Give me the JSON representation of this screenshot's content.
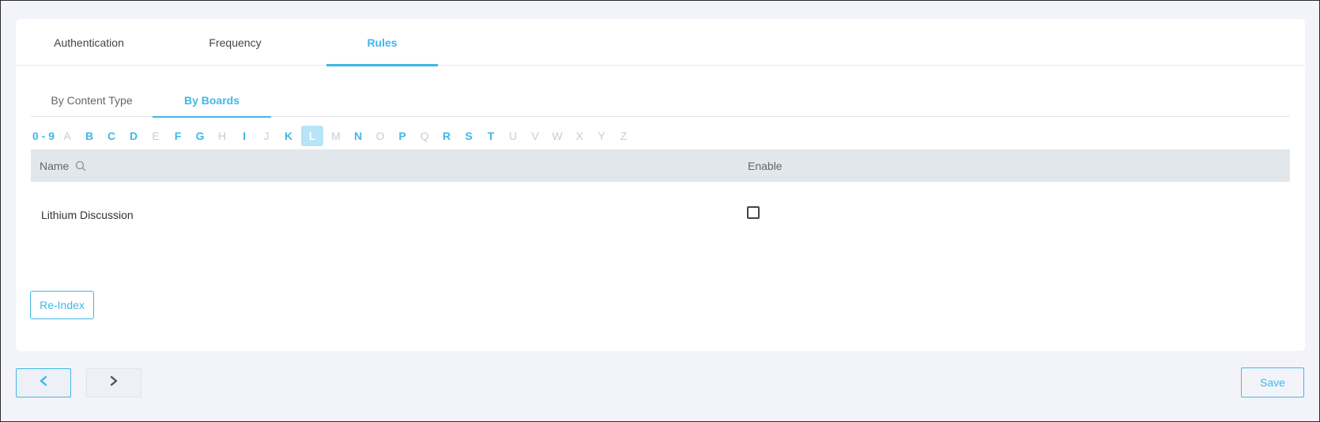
{
  "top_tabs": [
    {
      "label": "Authentication",
      "active": false
    },
    {
      "label": "Frequency",
      "active": false
    },
    {
      "label": "Rules",
      "active": true
    }
  ],
  "sub_tabs": [
    {
      "label": "By Content Type",
      "active": false
    },
    {
      "label": "By Boards",
      "active": true
    }
  ],
  "alphabet": [
    {
      "label": "0 - 9",
      "state": "on"
    },
    {
      "label": "A",
      "state": "off"
    },
    {
      "label": "B",
      "state": "on"
    },
    {
      "label": "C",
      "state": "on"
    },
    {
      "label": "D",
      "state": "on"
    },
    {
      "label": "E",
      "state": "off"
    },
    {
      "label": "F",
      "state": "on"
    },
    {
      "label": "G",
      "state": "on"
    },
    {
      "label": "H",
      "state": "off"
    },
    {
      "label": "I",
      "state": "on"
    },
    {
      "label": "J",
      "state": "off"
    },
    {
      "label": "K",
      "state": "on"
    },
    {
      "label": "L",
      "state": "selected"
    },
    {
      "label": "M",
      "state": "off"
    },
    {
      "label": "N",
      "state": "on"
    },
    {
      "label": "O",
      "state": "off"
    },
    {
      "label": "P",
      "state": "on"
    },
    {
      "label": "Q",
      "state": "off"
    },
    {
      "label": "R",
      "state": "on"
    },
    {
      "label": "S",
      "state": "on"
    },
    {
      "label": "T",
      "state": "on"
    },
    {
      "label": "U",
      "state": "off"
    },
    {
      "label": "V",
      "state": "off"
    },
    {
      "label": "W",
      "state": "off"
    },
    {
      "label": "X",
      "state": "off"
    },
    {
      "label": "Y",
      "state": "off"
    },
    {
      "label": "Z",
      "state": "off"
    }
  ],
  "table": {
    "columns": {
      "name": "Name",
      "enable": "Enable"
    },
    "rows": [
      {
        "name": "Lithium Discussion",
        "enabled": false
      }
    ]
  },
  "buttons": {
    "reindex": "Re-Index",
    "save": "Save"
  },
  "icons": {
    "search": "search-icon",
    "prev": "chevron-left-icon",
    "next": "chevron-right-icon"
  },
  "colors": {
    "accent": "#3fb8e8",
    "header_bg": "#e1e7ea",
    "disabled_letter": "#c9ccd3"
  }
}
